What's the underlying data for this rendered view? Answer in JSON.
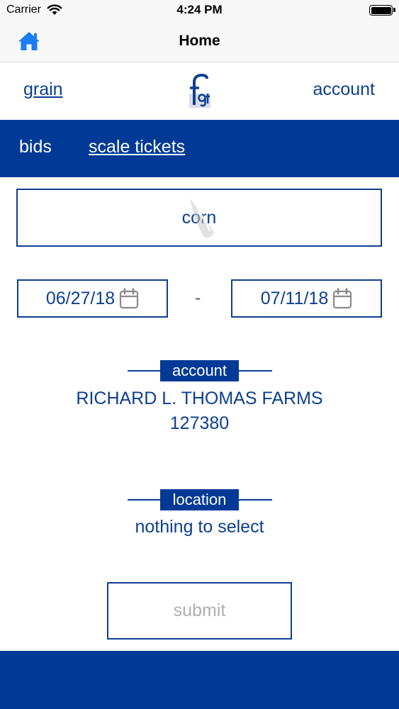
{
  "status_bar": {
    "carrier": "Carrier",
    "time": "4:24 PM",
    "icons": [
      "wifi-icon",
      "battery-icon"
    ]
  },
  "nav": {
    "title": "Home",
    "home_icon": "home-icon"
  },
  "top_links": {
    "grain": "grain",
    "account": "account",
    "logo_icon": "fgt-logo"
  },
  "tabs": [
    {
      "label": "bids",
      "selected": false
    },
    {
      "label": "scale tickets",
      "selected": true
    }
  ],
  "commodity": {
    "value": "corn"
  },
  "date_range": {
    "start": "06/27/18",
    "separator": "-",
    "end": "07/11/18",
    "icon": "calendar-icon"
  },
  "account_section": {
    "label": "account",
    "name": "RICHARD L. THOMAS FARMS",
    "number": "127380"
  },
  "location_section": {
    "label": "location",
    "value": "nothing to select"
  },
  "submit": {
    "label": "submit"
  },
  "colors": {
    "primary": "#003a96",
    "text": "#0d3f91",
    "disabled_text": "#b0b0b0",
    "ios_blue": "#1b7cf5",
    "nav_bg": "#f7f7f7"
  }
}
